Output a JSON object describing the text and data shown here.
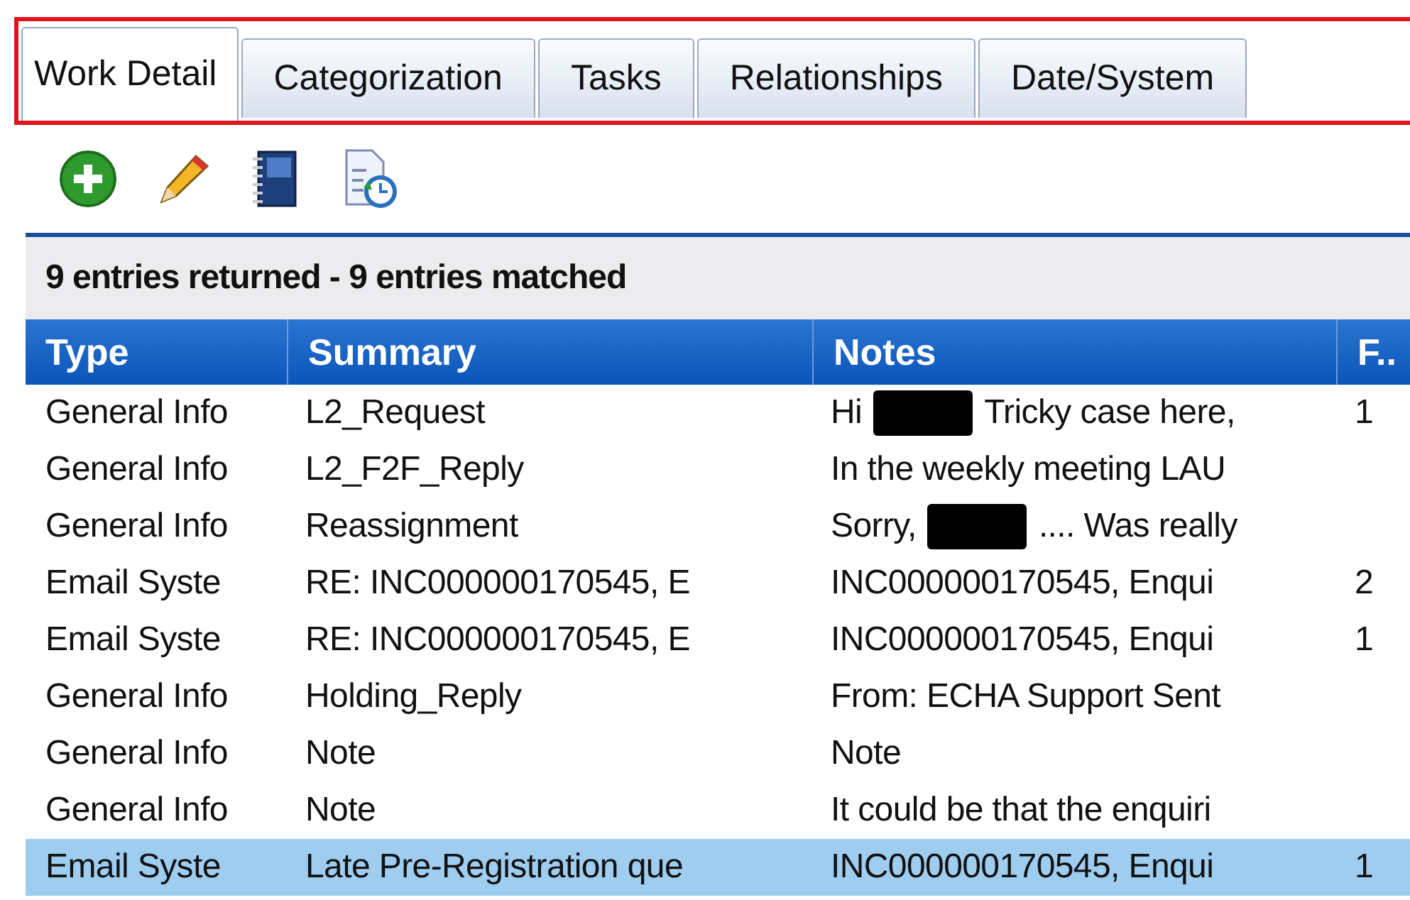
{
  "tabs": [
    {
      "label": "Work Detail",
      "selected": true
    },
    {
      "label": "Categorization",
      "selected": false
    },
    {
      "label": "Tasks",
      "selected": false
    },
    {
      "label": "Relationships",
      "selected": false
    },
    {
      "label": "Date/System",
      "selected": false
    }
  ],
  "toolbar": [
    {
      "kind": "add"
    },
    {
      "kind": "edit"
    },
    {
      "kind": "notebook"
    },
    {
      "kind": "history"
    }
  ],
  "table": {
    "status": "9 entries returned - 9 entries matched",
    "columns": [
      "Type",
      "Summary",
      "Notes",
      "F.."
    ],
    "rows": [
      {
        "type": "General Info",
        "summary": "L2_Request",
        "notes": [
          {
            "kind": "text",
            "text": "Hi"
          },
          {
            "kind": "redacted"
          },
          {
            "kind": "text",
            "text": "Tricky case here,"
          }
        ],
        "column_4": "1",
        "selected": false
      },
      {
        "type": "General Info",
        "summary": "L2_F2F_Reply",
        "notes": [
          {
            "kind": "text",
            "text": "In the weekly meeting LAU"
          }
        ],
        "selected": false
      },
      {
        "type": "General Info",
        "summary": "Reassignment",
        "notes": [
          {
            "kind": "text",
            "text": "Sorry,"
          },
          {
            "kind": "redacted"
          },
          {
            "kind": "text",
            "text": ".... Was really"
          }
        ],
        "selected": false
      },
      {
        "type": "Email Syste",
        "summary": "RE: INC000000170545, E",
        "notes": [
          {
            "kind": "text",
            "text": "INC000000170545, Enqui"
          }
        ],
        "column_4": "2",
        "selected": false
      },
      {
        "type": "Email Syste",
        "summary": "RE: INC000000170545, E",
        "notes": [
          {
            "kind": "text",
            "text": "INC000000170545, Enqui"
          }
        ],
        "column_4": "1",
        "selected": false
      },
      {
        "type": "General Info",
        "summary": "Holding_Reply",
        "notes": [
          {
            "kind": "text",
            "text": "From: ECHA Support Sent"
          }
        ],
        "selected": false
      },
      {
        "type": "General Info",
        "summary": "Note",
        "notes": [
          {
            "kind": "text",
            "text": "Note"
          }
        ],
        "selected": false
      },
      {
        "type": "General Info",
        "summary": "Note",
        "notes": [
          {
            "kind": "text",
            "text": "It could be that the enquiri"
          }
        ],
        "selected": false
      },
      {
        "type": "Email Syste",
        "summary": "Late Pre-Registration que",
        "notes": [
          {
            "kind": "text",
            "text": "INC000000170545, Enqui"
          }
        ],
        "column_4": "1",
        "selected": true
      }
    ]
  }
}
